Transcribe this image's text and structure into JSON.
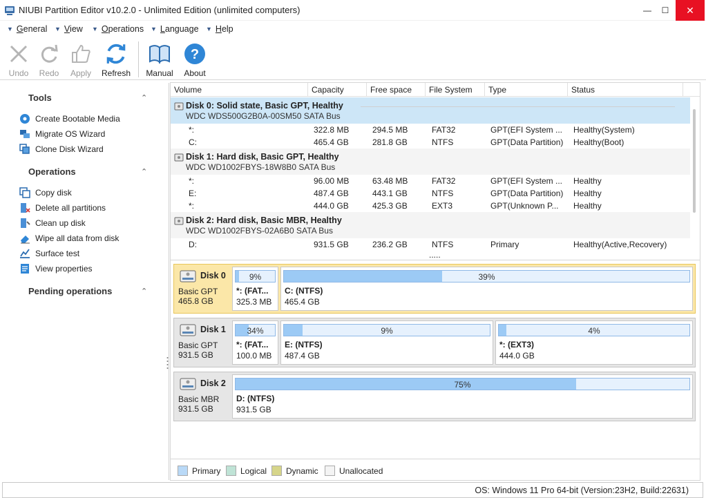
{
  "window": {
    "title": "NIUBI Partition Editor v10.2.0 - Unlimited Edition (unlimited computers)",
    "minimize": "—",
    "maximize": "☐",
    "close": "✕"
  },
  "menu": {
    "items": [
      {
        "label": "General",
        "u": "G",
        "rest": "eneral"
      },
      {
        "label": "View",
        "u": "V",
        "rest": "iew"
      },
      {
        "label": "Operations",
        "u": "O",
        "rest": "perations"
      },
      {
        "label": "Language",
        "u": "L",
        "rest": "anguage"
      },
      {
        "label": "Help",
        "u": "H",
        "rest": "elp"
      }
    ]
  },
  "toolbar": {
    "undo": "Undo",
    "redo": "Redo",
    "apply": "Apply",
    "refresh": "Refresh",
    "manual": "Manual",
    "about": "About"
  },
  "left_panel": {
    "tools_title": "Tools",
    "tools": [
      "Create Bootable Media",
      "Migrate OS Wizard",
      "Clone Disk Wizard"
    ],
    "operations_title": "Operations",
    "operations": [
      "Copy disk",
      "Delete all partitions",
      "Clean up disk",
      "Wipe all data from disk",
      "Surface test",
      "View properties"
    ],
    "pending_title": "Pending operations"
  },
  "table": {
    "headers": [
      "Volume",
      "Capacity",
      "Free space",
      "File System",
      "Type",
      "Status"
    ],
    "disks": [
      {
        "title": "Disk 0: Solid state, Basic GPT, Healthy",
        "model": "WDC  WDS500G2B0A-00SM50 SATA Bus",
        "rows": [
          [
            "*:",
            "322.8 MB",
            "294.5 MB",
            "FAT32",
            "GPT(EFI System ...",
            "Healthy(System)"
          ],
          [
            "C:",
            "465.4 GB",
            "281.8 GB",
            "NTFS",
            "GPT(Data Partition)",
            "Healthy(Boot)"
          ]
        ]
      },
      {
        "title": "Disk 1: Hard disk, Basic GPT, Healthy",
        "model": "WDC WD1002FBYS-18W8B0 SATA Bus",
        "rows": [
          [
            "*:",
            "96.00 MB",
            "63.48 MB",
            "FAT32",
            "GPT(EFI System ...",
            "Healthy"
          ],
          [
            "E:",
            "487.4 GB",
            "443.1 GB",
            "NTFS",
            "GPT(Data Partition)",
            "Healthy"
          ],
          [
            "*:",
            "444.0 GB",
            "425.3 GB",
            "EXT3",
            "GPT(Unknown P...",
            "Healthy"
          ]
        ]
      },
      {
        "title": "Disk 2: Hard disk, Basic MBR, Healthy",
        "model": "WDC WD1002FBYS-02A6B0 SATA Bus",
        "rows": [
          [
            "D:",
            "931.5 GB",
            "236.2 GB",
            "NTFS",
            "Primary",
            "Healthy(Active,Recovery)"
          ]
        ]
      }
    ],
    "more": "....."
  },
  "diskmap": [
    {
      "name": "Disk 0",
      "type": "Basic GPT",
      "size": "465.8 GB",
      "partitions": [
        {
          "pct_label": "9%",
          "used": 0.09,
          "name": "*: (FAT...",
          "size": "325.3 MB"
        },
        {
          "pct_label": "39%",
          "used": 0.39,
          "name": "C: (NTFS)",
          "size": "465.4 GB"
        }
      ]
    },
    {
      "name": "Disk 1",
      "type": "Basic GPT",
      "size": "931.5 GB",
      "partitions": [
        {
          "pct_label": "34%",
          "used": 0.34,
          "name": "*: (FAT...",
          "size": "100.0 MB"
        },
        {
          "pct_label": "9%",
          "used": 0.09,
          "name": "E: (NTFS)",
          "size": "487.4 GB"
        },
        {
          "pct_label": "4%",
          "used": 0.04,
          "name": "*: (EXT3)",
          "size": "444.0 GB"
        }
      ]
    },
    {
      "name": "Disk 2",
      "type": "Basic MBR",
      "size": "931.5 GB",
      "partitions": [
        {
          "pct_label": "75%",
          "used": 0.75,
          "name": "D: (NTFS)",
          "size": "931.5 GB"
        }
      ]
    }
  ],
  "legend": [
    {
      "label": "Primary",
      "color": "#b9d9f7"
    },
    {
      "label": "Logical",
      "color": "#bfe3d6"
    },
    {
      "label": "Dynamic",
      "color": "#d6d58a"
    },
    {
      "label": "Unallocated",
      "color": "#f4f4f4"
    }
  ],
  "status": "OS: Windows 11 Pro 64-bit (Version:23H2, Build:22631)"
}
